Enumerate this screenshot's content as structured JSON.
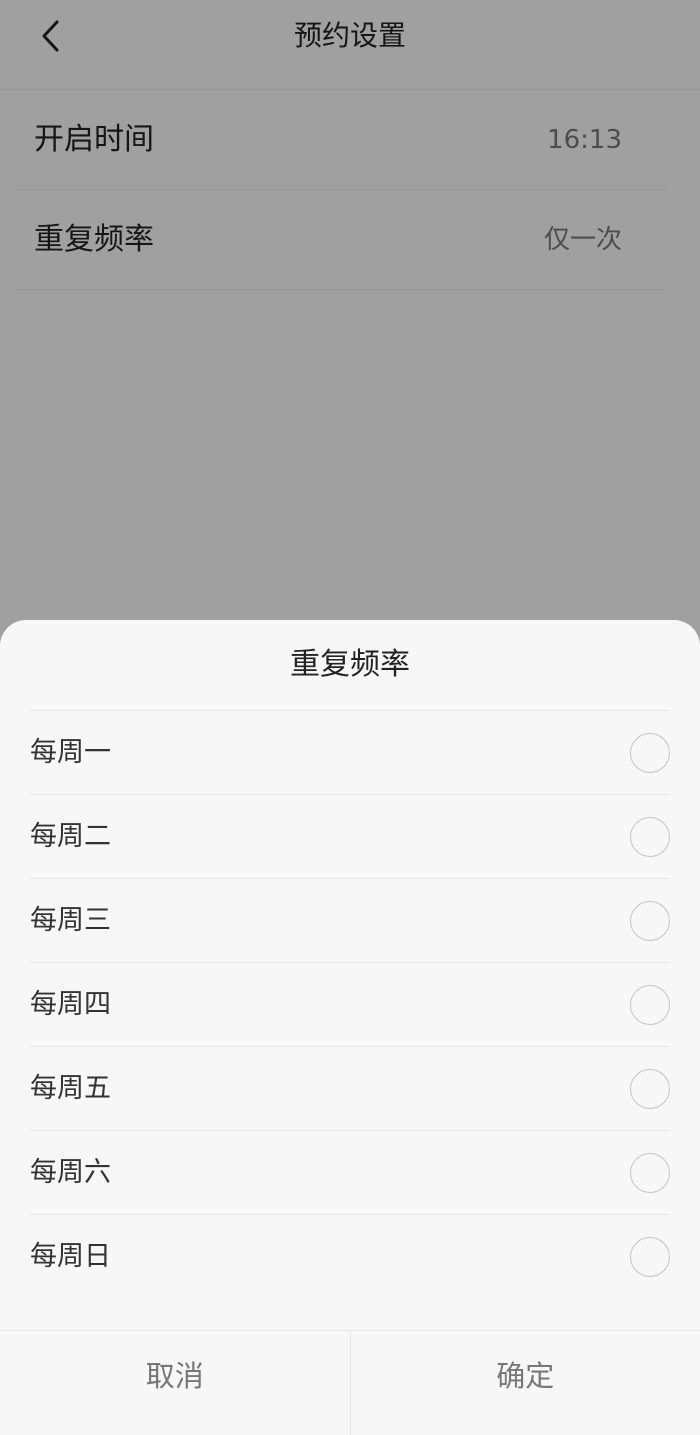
{
  "header": {
    "title": "预约设置",
    "back_icon": "chevron-left-icon"
  },
  "settings": {
    "start_time": {
      "label": "开启时间",
      "value": "16:13"
    },
    "repeat": {
      "label": "重复频率",
      "value": "仅一次"
    }
  },
  "sheet": {
    "title": "重复频率",
    "options": [
      {
        "label": "每周一",
        "selected": false
      },
      {
        "label": "每周二",
        "selected": false
      },
      {
        "label": "每周三",
        "selected": false
      },
      {
        "label": "每周四",
        "selected": false
      },
      {
        "label": "每周五",
        "selected": false
      },
      {
        "label": "每周六",
        "selected": false
      },
      {
        "label": "每周日",
        "selected": false
      }
    ],
    "cancel_label": "取消",
    "confirm_label": "确定"
  },
  "colors": {
    "overlay": "#000000",
    "text_primary": "#222222",
    "text_secondary": "#777777",
    "radio_border": "#c4c4c4"
  }
}
